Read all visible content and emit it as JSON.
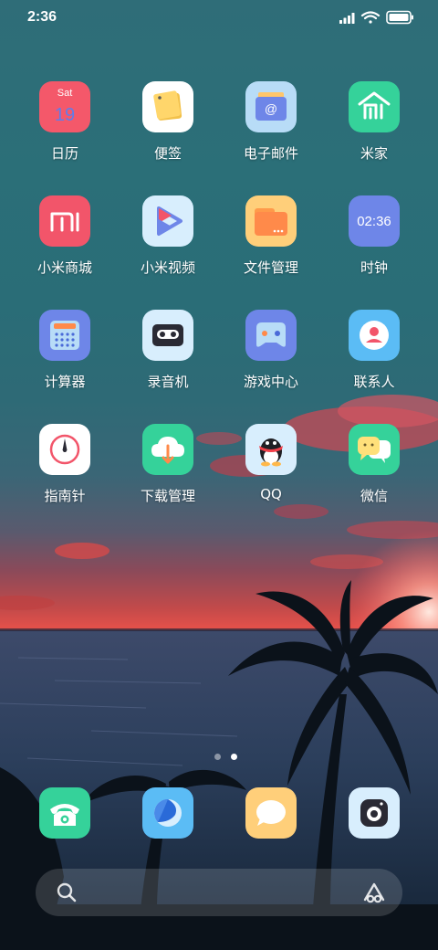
{
  "status_bar": {
    "time": "2:36",
    "icons": [
      "signal-icon",
      "wifi-icon",
      "battery-icon"
    ]
  },
  "apps": [
    {
      "name": "calendar-app",
      "label": "日历",
      "icon": "calendar-icon",
      "icon_text_top": "Sat",
      "icon_text_main": "19",
      "color": "#f4586a"
    },
    {
      "name": "notes-app",
      "label": "便签",
      "icon": "notes-icon",
      "color": "#ffffff"
    },
    {
      "name": "email-app",
      "label": "电子邮件",
      "icon": "email-icon",
      "icon_text_main": "@",
      "color": "#b8dcf7"
    },
    {
      "name": "mijia-app",
      "label": "米家",
      "icon": "mijia-home-icon",
      "color": "#35d29a"
    },
    {
      "name": "mi-store-app",
      "label": "小米商城",
      "icon": "mi-logo-icon",
      "color": "#f2556a"
    },
    {
      "name": "mi-video-app",
      "label": "小米视频",
      "icon": "play-icon",
      "color": "#d8eefd"
    },
    {
      "name": "file-manager-app",
      "label": "文件管理",
      "icon": "folder-icon",
      "color": "#ffcf7a"
    },
    {
      "name": "clock-app",
      "label": "时钟",
      "icon": "clock-icon",
      "icon_text_main": "02:36",
      "color": "#6e86e8"
    },
    {
      "name": "calculator-app",
      "label": "计算器",
      "icon": "calculator-icon",
      "color": "#6e86e8"
    },
    {
      "name": "recorder-app",
      "label": "录音机",
      "icon": "recorder-icon",
      "color": "#d8eefd"
    },
    {
      "name": "game-center-app",
      "label": "游戏中心",
      "icon": "gamepad-icon",
      "color": "#6e86e8"
    },
    {
      "name": "contacts-app",
      "label": "联系人",
      "icon": "contact-icon",
      "color": "#5bbcf5"
    },
    {
      "name": "compass-app",
      "label": "指南针",
      "icon": "compass-icon",
      "color": "#ffffff"
    },
    {
      "name": "download-manager-app",
      "label": "下载管理",
      "icon": "cloud-download-icon",
      "color": "#35d29a"
    },
    {
      "name": "qq-app",
      "label": "QQ",
      "icon": "qq-penguin-icon",
      "color": "#d8eefd"
    },
    {
      "name": "wechat-app",
      "label": "微信",
      "icon": "wechat-icon",
      "color": "#35d29a"
    }
  ],
  "page_indicator": {
    "pages": 2,
    "current": 2
  },
  "dock": [
    {
      "name": "phone-app",
      "icon": "phone-icon",
      "color": "#35d29a"
    },
    {
      "name": "browser-app",
      "icon": "browser-icon",
      "color": "#5bbcf5"
    },
    {
      "name": "messages-app",
      "icon": "message-icon",
      "color": "#ffcf7a"
    },
    {
      "name": "camera-app",
      "icon": "camera-icon",
      "color": "#d8eefd"
    }
  ],
  "search_bar": {
    "left_icon": "search-icon",
    "right_icon": "assistant-icon"
  }
}
